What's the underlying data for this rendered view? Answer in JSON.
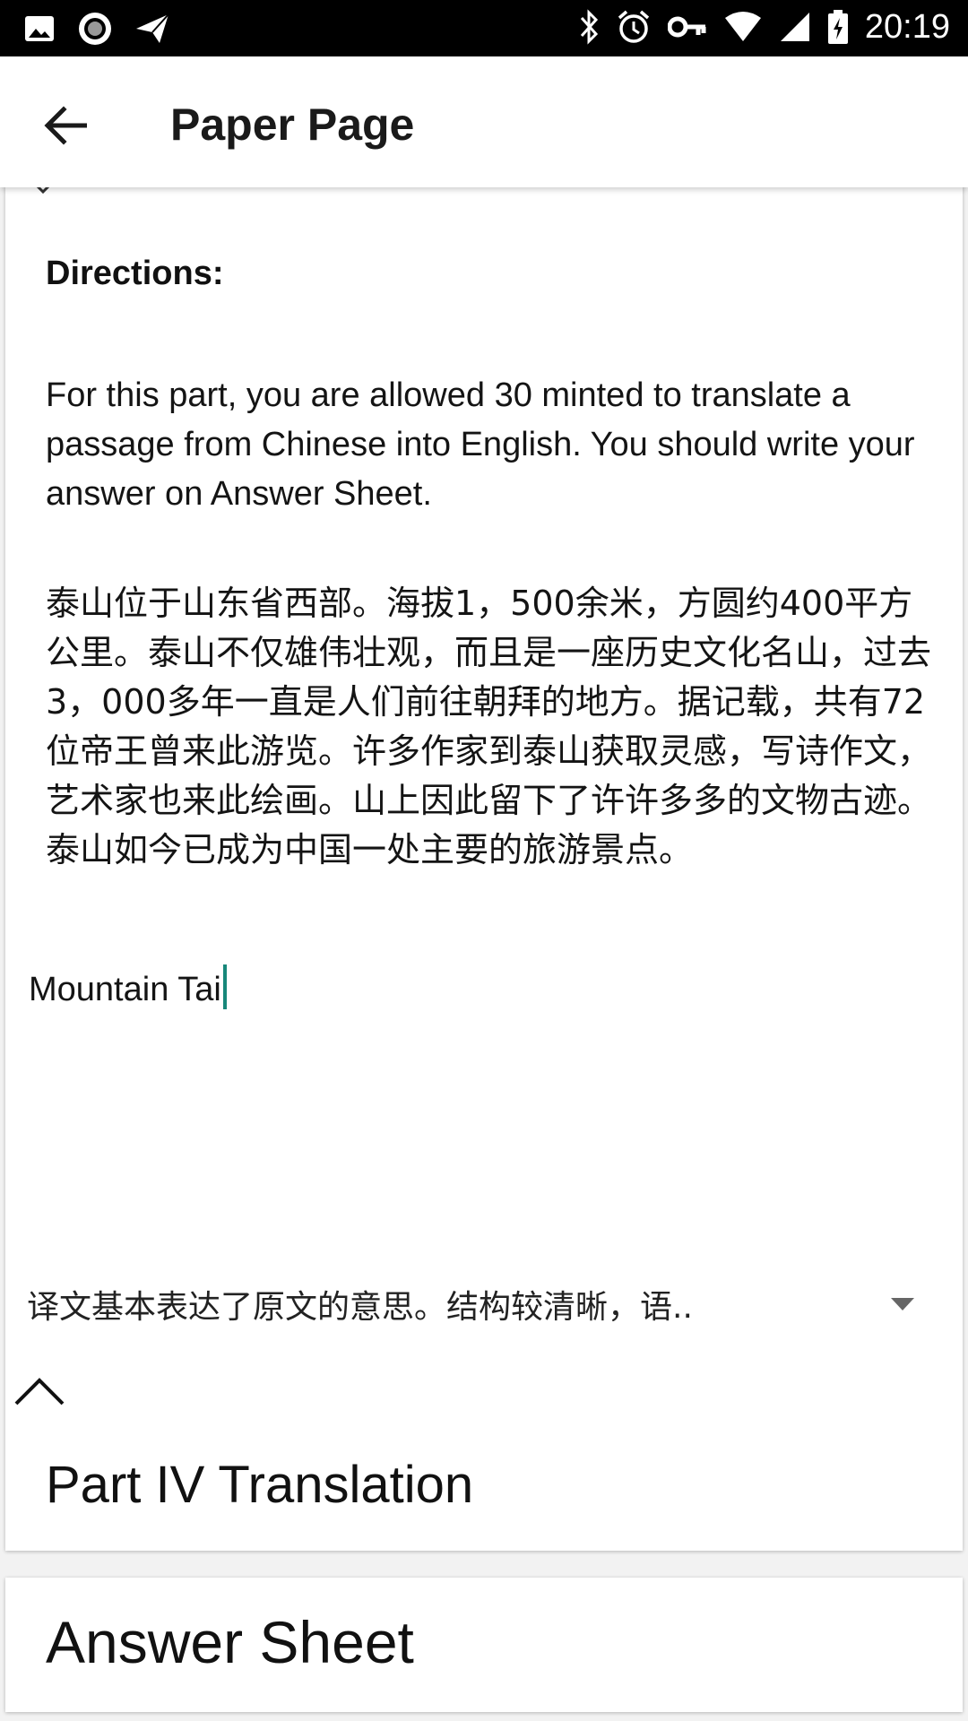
{
  "status_bar": {
    "time": "20:19",
    "left_icons": [
      "image-icon",
      "record-icon",
      "send-icon"
    ],
    "right_icons": [
      "bluetooth-icon",
      "alarm-icon",
      "vpn-key-icon",
      "wifi-icon",
      "signal-icon",
      "battery-charging-icon"
    ]
  },
  "app_bar": {
    "back_icon": "arrow-left-icon",
    "title": "Paper Page"
  },
  "question": {
    "directions_heading": "Directions:",
    "directions_body": "For this part, you are allowed 30 minted to translate a passage from Chinese into English. You should write your answer on Answer Sheet.",
    "passage": "泰山位于山东省西部。海拔1，500余米，方圆约400平方公里。泰山不仅雄伟壮观，而且是一座历史文化名山，过去3，000多年一直是人们前往朝拜的地方。据记载，共有72位帝王曾来此游览。许多作家到泰山获取灵感，写诗作文，艺术家也来此绘画。山上因此留下了许许多多的文物古迹。泰山如今已成为中国一处主要的旅游景点。",
    "answer_value": "Mountain Tai",
    "feedback_selected": "译文基本表达了原文的意思。结构较清晰，语..",
    "section_title": "Part IV Translation"
  },
  "answer_sheet": {
    "title": "Answer Sheet"
  },
  "colors": {
    "status_bar": "#000000",
    "cursor": "#17877a",
    "card": "#ffffff",
    "background": "#f2f2f2"
  }
}
